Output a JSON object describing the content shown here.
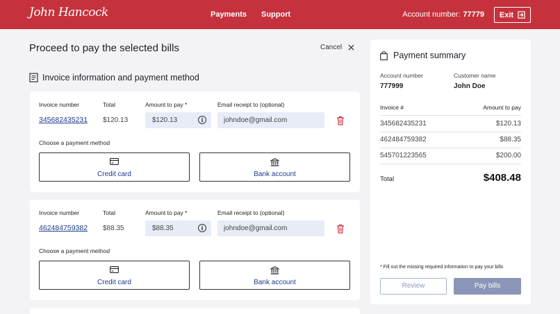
{
  "header": {
    "logo_text": "John Hancock",
    "nav": [
      "Payments",
      "Support"
    ],
    "account_label": "Account number:",
    "account_value": "77779",
    "exit_label": "Exit"
  },
  "page": {
    "title": "Proceed to pay the selected bills",
    "cancel_label": "Cancel",
    "section_title": "Invoice information and payment method"
  },
  "labels": {
    "invoice_number": "Invoice number",
    "total": "Total",
    "amount_to_pay": "Amount to pay *",
    "email_receipt": "Email receipt to (optional)",
    "choose_method": "Choose a payment method",
    "credit_card": "Credit card",
    "bank_account": "Bank account"
  },
  "invoices": [
    {
      "number": "345682435231",
      "total": "$120.13",
      "amount": "$120.13",
      "email_placeholder": "johndoe@gmail.com"
    },
    {
      "number": "462484759382",
      "total": "$88.35",
      "amount": "$88.35",
      "email_placeholder": "johndoe@gmail.com"
    }
  ],
  "summary": {
    "title": "Payment summary",
    "account_label": "Account number",
    "account_value": "777999",
    "customer_label": "Customer name",
    "customer_value": "John Doe",
    "col_invoice": "Invoice #",
    "col_amount": "Amount to pay",
    "rows": [
      {
        "invoice": "345682435231",
        "amount": "$120.13"
      },
      {
        "invoice": "462484759382",
        "amount": "$88.35"
      },
      {
        "invoice": "545701223565",
        "amount": "$200.00"
      }
    ],
    "total_label": "Total",
    "total_value": "$408.48",
    "note": "* Fill out the missing required information to pay your bills",
    "review_label": "Review",
    "pay_label": "Pay bills"
  },
  "colors": {
    "brand_red": "#c5323d",
    "link_blue": "#1a3a8c",
    "pay_disabled": "#8a95b8",
    "trash_red": "#d0343f"
  }
}
